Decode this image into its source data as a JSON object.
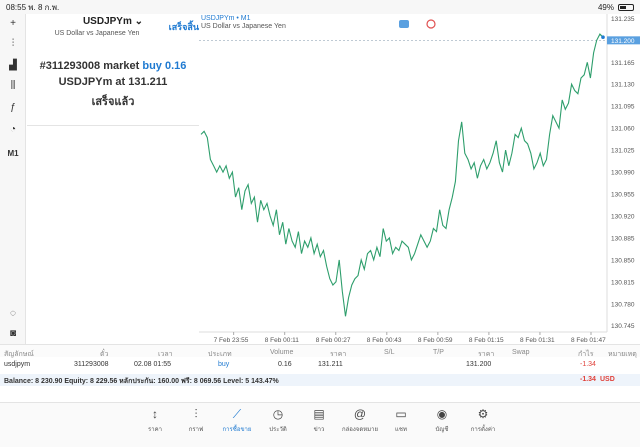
{
  "statusbar": {
    "time": "08:55",
    "date": "พ. 8 ก.พ.",
    "battery": "49%",
    "battery_level": 0.49
  },
  "order_panel": {
    "symbol": "USDJPYm",
    "description": "US Dollar vs Japanese Yen",
    "done_label": "เสร็จสิ้น",
    "order_id": "#311293008",
    "order_type": "market",
    "side": "buy",
    "volume": "0.16",
    "price_text": "USDJPYm at",
    "price": "131.211",
    "status": "เสร็จแล้ว"
  },
  "chart_header": {
    "title": "USDJPYm • M1",
    "subtitle": "US Dollar vs Japanese Yen"
  },
  "chart_data": {
    "type": "line",
    "color": "#2e9e6c",
    "y_ticks": [
      "131.235",
      "131.200",
      "131.165",
      "131.130",
      "131.095",
      "131.060",
      "131.025",
      "130.990",
      "130.955",
      "130.920",
      "130.885",
      "130.850",
      "130.815",
      "130.780",
      "130.745"
    ],
    "ylim": [
      130.735,
      131.242
    ],
    "x_ticks": [
      "7 Feb 23:55",
      "8 Feb 00:11",
      "8 Feb 00:27",
      "8 Feb 00:43",
      "8 Feb 00:59",
      "8 Feb 01:15",
      "8 Feb 01:31",
      "8 Feb 01:47"
    ],
    "current_price": "131.200",
    "values": [
      131.05,
      131.055,
      131.045,
      131.01,
      131.0,
      130.99,
      131.0,
      130.99,
      131.0,
      130.98,
      130.99,
      130.95,
      130.965,
      130.93,
      130.96,
      130.97,
      130.94,
      130.95,
      130.91,
      130.945,
      130.93,
      130.94,
      130.92,
      130.905,
      130.93,
      130.89,
      130.91,
      130.875,
      130.9,
      130.88,
      130.87,
      130.895,
      130.86,
      130.88,
      130.87,
      130.885,
      130.86,
      130.875,
      130.855,
      130.865,
      130.84,
      130.82,
      130.81,
      130.815,
      130.85,
      130.8,
      130.76,
      130.79,
      130.81,
      130.82,
      130.825,
      130.85,
      130.835,
      130.86,
      130.865,
      130.85,
      130.87,
      130.855,
      130.9,
      130.88,
      130.885,
      130.86,
      130.87,
      130.865,
      130.88,
      130.875,
      130.87,
      130.85,
      130.86,
      130.875,
      130.89,
      130.88,
      130.87,
      130.88,
      130.9,
      130.895,
      130.93,
      130.905,
      130.9,
      130.93,
      130.95,
      130.975,
      131.04,
      131.07,
      131.02,
      131.01,
      130.995,
      131.005,
      130.98,
      131.0,
      131.01,
      130.995,
      131.005,
      131.02,
      131.04,
      131.005,
      130.99,
      131.025,
      131.0,
      131.02,
      131.05,
      131.045,
      131.06,
      131.04,
      131.035,
      131.02,
      130.995,
      131.005,
      131.02,
      131.0,
      131.01,
      131.05,
      131.08,
      131.07,
      131.06,
      131.105,
      131.09,
      131.1,
      131.13,
      131.12,
      131.115,
      131.14,
      131.145,
      131.165,
      131.14,
      131.18,
      131.2,
      131.21,
      131.205
    ]
  },
  "positions": {
    "headers": {
      "symbol": "สัญลักษณ์",
      "ticket": "ตั๋ว",
      "time": "เวลา",
      "type": "ประเภท",
      "volume": "Volume",
      "price": "ราคา",
      "sl": "S/L",
      "tp": "T/P",
      "current": "ราคา",
      "swap": "Swap",
      "profit": "กำไร",
      "comment": "หมายเหตุ"
    },
    "rows": [
      {
        "symbol": "usdjpym",
        "ticket": "311293008",
        "time": "02.08 01:55",
        "type": "buy",
        "volume": "0.16",
        "price": "131.211",
        "current": "131.200",
        "profit": "-1.34"
      }
    ]
  },
  "balance": {
    "text": "Balance: 8 230.90 Equity: 8 229.56 หลักประกัน: 160.00 ฟรี: 8 069.56 Level: 5 143.47%",
    "profit": "-1.34",
    "currency": "USD"
  },
  "tabs": [
    {
      "label": "ราคา",
      "icon": "↕"
    },
    {
      "label": "กราฟ",
      "icon": "⫶"
    },
    {
      "label": "การซื้อขาย",
      "icon": "⟋"
    },
    {
      "label": "ประวัติ",
      "icon": "◷"
    },
    {
      "label": "ข่าว",
      "icon": "▤"
    },
    {
      "label": "กล่องจดหมาย",
      "icon": "@"
    },
    {
      "label": "แชท",
      "icon": "▭"
    },
    {
      "label": "บัญชี",
      "icon": "◉"
    },
    {
      "label": "การตั้งค่า",
      "icon": "⚙"
    }
  ],
  "left_tools": [
    {
      "name": "crosshair-icon",
      "glyph": "+"
    },
    {
      "name": "candle-icon",
      "glyph": "⫶"
    },
    {
      "name": "chart-type-icon",
      "glyph": "▟"
    },
    {
      "name": "indicator-icon",
      "glyph": "⫼"
    },
    {
      "name": "function-icon",
      "glyph": "ƒ"
    },
    {
      "name": "objects-icon",
      "glyph": "◔"
    },
    {
      "name": "timeframe-label",
      "glyph": "M1"
    },
    {
      "name": "chat-icon",
      "glyph": "◌"
    },
    {
      "name": "record-icon",
      "glyph": "◙"
    }
  ]
}
